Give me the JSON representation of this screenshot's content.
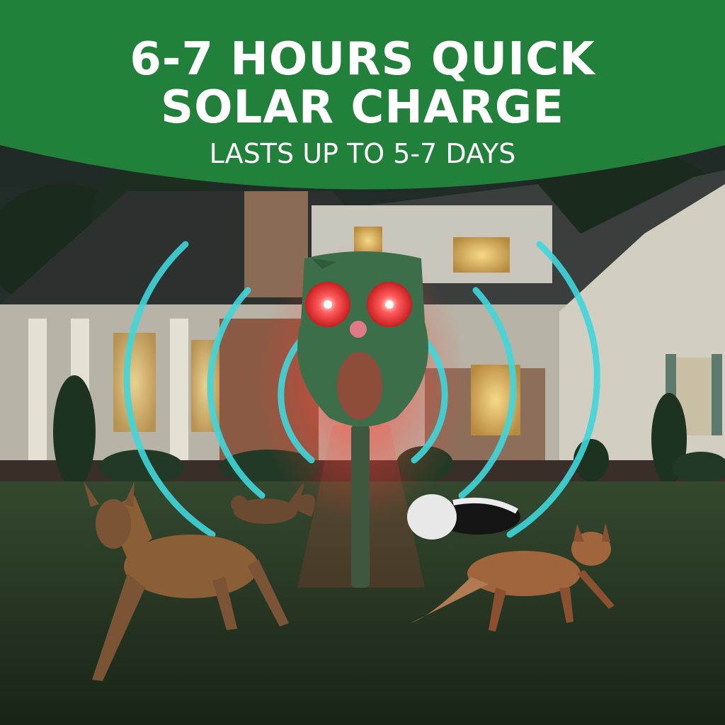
{
  "banner": {
    "headline_line1": "6-7 HOURS QUICK",
    "headline_line2": "SOLAR CHARGE",
    "subheadline": "LASTS UP TO 5-7 DAYS"
  },
  "colors": {
    "banner_green": "#21813a",
    "wave_cyan": "#3fd6dc",
    "eye_red": "#ff4a4a",
    "owl_green": "#3c6e4a",
    "lawn": "#2a3d2a"
  }
}
